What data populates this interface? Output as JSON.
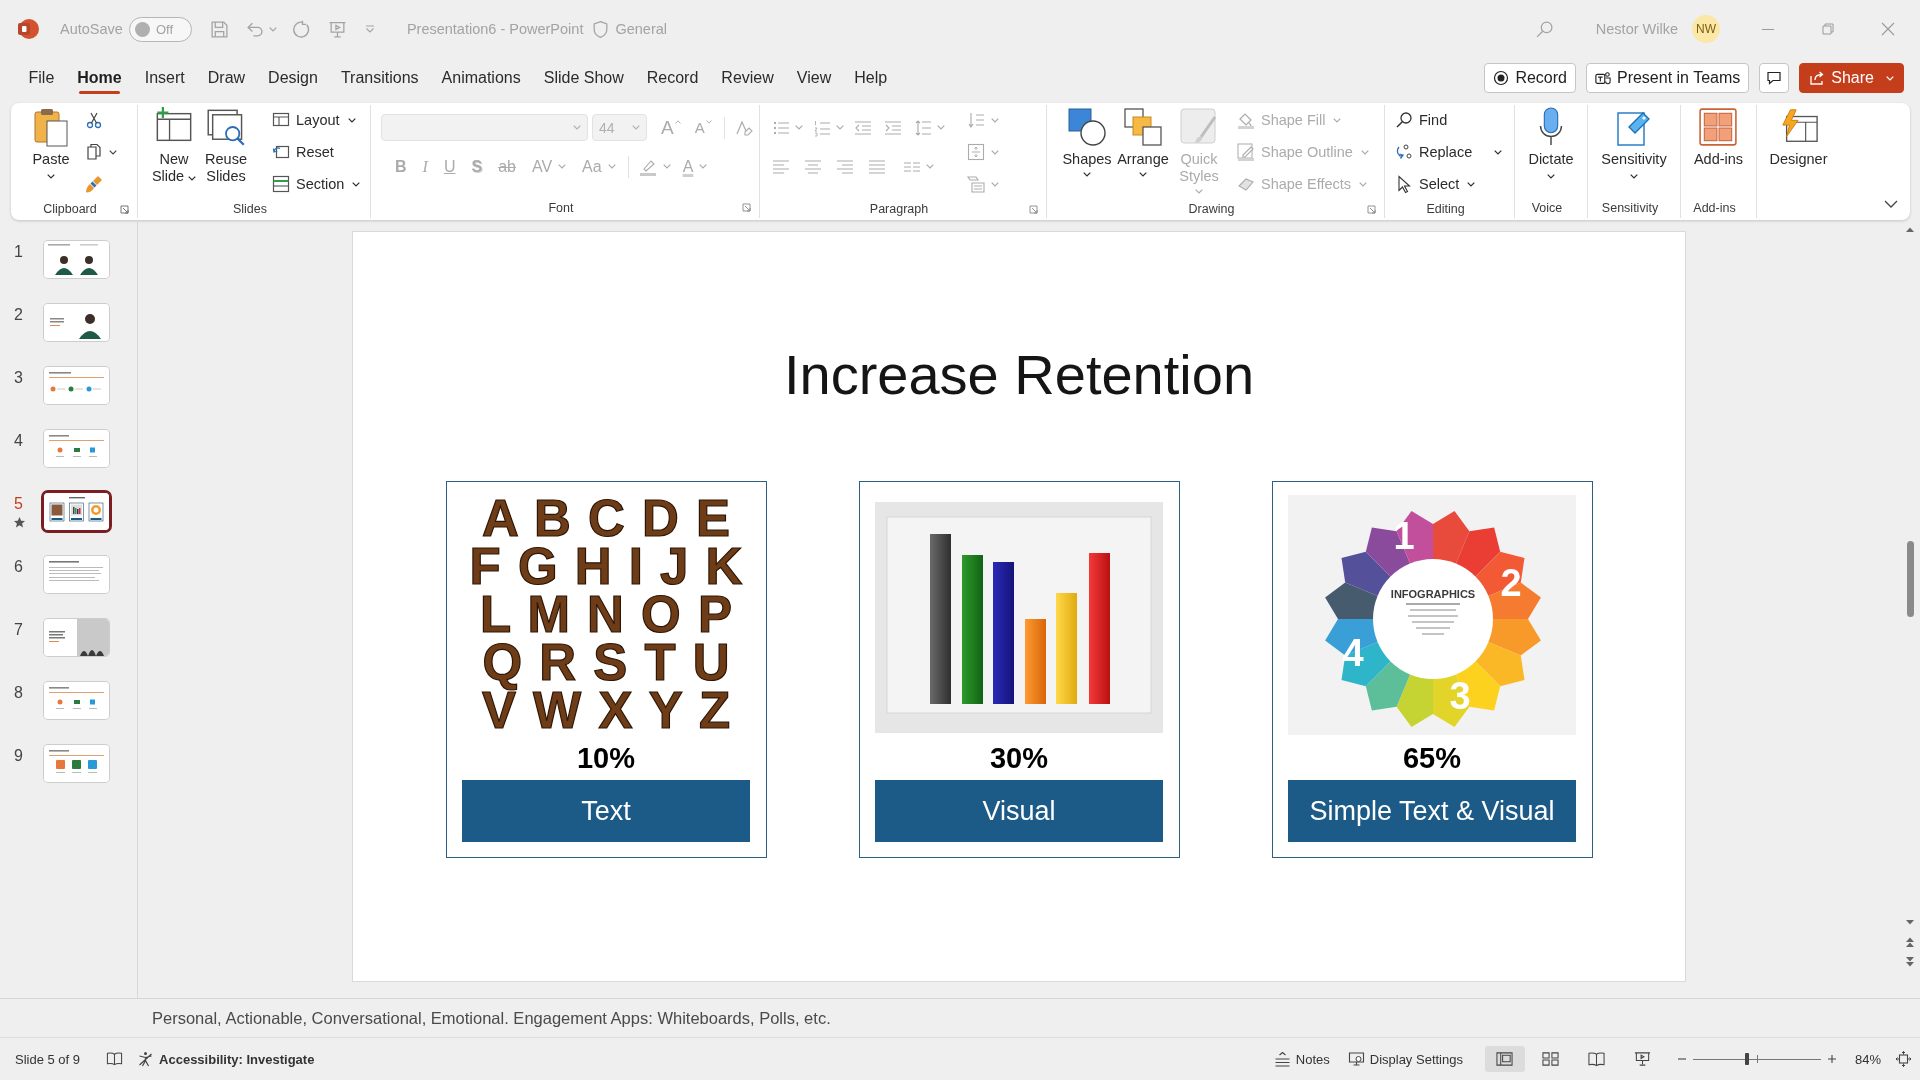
{
  "title_bar": {
    "autosave": {
      "label": "AutoSave",
      "state": "Off",
      "on": false
    },
    "document_title": "Presentation6 - PowerPoint",
    "sensitivity": "General",
    "user_name": "Nestor Wilke",
    "user_initials": "NW"
  },
  "tabs": [
    {
      "label": "File",
      "selected": false
    },
    {
      "label": "Home",
      "selected": true
    },
    {
      "label": "Insert",
      "selected": false
    },
    {
      "label": "Draw",
      "selected": false
    },
    {
      "label": "Design",
      "selected": false
    },
    {
      "label": "Transitions",
      "selected": false
    },
    {
      "label": "Animations",
      "selected": false
    },
    {
      "label": "Slide Show",
      "selected": false
    },
    {
      "label": "Record",
      "selected": false
    },
    {
      "label": "Review",
      "selected": false
    },
    {
      "label": "View",
      "selected": false
    },
    {
      "label": "Help",
      "selected": false
    }
  ],
  "tab_actions": [
    {
      "kind": "record",
      "label": "Record"
    },
    {
      "kind": "teams",
      "label": "Present in Teams"
    },
    {
      "kind": "comments"
    },
    {
      "kind": "share",
      "label": "Share"
    }
  ],
  "ribbon": {
    "clipboard": {
      "label": "Clipboard",
      "paste": "Paste"
    },
    "slides": {
      "label": "Slides",
      "large": [
        {
          "kind": "new_slide",
          "label": "New Slide",
          "caret": true
        },
        {
          "kind": "reuse",
          "label": "Reuse Slides",
          "caret": false
        }
      ],
      "small": [
        {
          "kind": "layout",
          "label": "Layout",
          "caret": true
        },
        {
          "kind": "reset",
          "label": "Reset",
          "caret": false
        },
        {
          "kind": "section",
          "label": "Section",
          "caret": true
        }
      ]
    },
    "font": {
      "label": "Font",
      "disabled": true,
      "size": "44",
      "size_buttons": [
        {
          "kind": "grow",
          "glyph": "A"
        },
        {
          "kind": "shrink",
          "glyph": "A"
        }
      ],
      "format": [
        {
          "kind": "bold",
          "glyph": "B",
          "caret": false
        },
        {
          "kind": "italic",
          "glyph": "I",
          "caret": false
        },
        {
          "kind": "underline",
          "glyph": "U",
          "caret": false
        },
        {
          "kind": "shadow",
          "glyph": "S",
          "caret": false
        },
        {
          "kind": "strike",
          "glyph": "ab",
          "caret": false
        },
        {
          "kind": "spacing",
          "glyph": "AV",
          "caret": true
        },
        {
          "kind": "case",
          "glyph": "Aa",
          "caret": true
        }
      ],
      "color_glyph": "A"
    },
    "paragraph": {
      "label": "Paragraph",
      "disabled": true
    },
    "drawing": {
      "label": "Drawing",
      "large": [
        {
          "kind": "shapes",
          "label": "Shapes",
          "disabled": false
        },
        {
          "kind": "arrange",
          "label": "Arrange",
          "disabled": false
        },
        {
          "kind": "styles",
          "label": "Quick Styles",
          "disabled": true
        }
      ],
      "small": [
        {
          "kind": "fill",
          "label": "Shape Fill",
          "disabled": true
        },
        {
          "kind": "outline",
          "label": "Shape Outline",
          "disabled": true
        },
        {
          "kind": "effects",
          "label": "Shape Effects",
          "disabled": true
        }
      ]
    },
    "editing": {
      "label": "Editing",
      "items": [
        {
          "kind": "find",
          "label": "Find",
          "caret": false
        },
        {
          "kind": "replace",
          "label": "Replace",
          "caret": true
        },
        {
          "kind": "select",
          "label": "Select",
          "caret": true
        }
      ]
    },
    "voice": {
      "label": "Voice",
      "button": "Dictate"
    },
    "sensitivity": {
      "label": "Sensitivity",
      "button": "Sensitivity"
    },
    "addins": {
      "label": "Add-ins",
      "button": "Add-ins"
    },
    "designer": {
      "button": "Designer"
    }
  },
  "thumbnails": [
    {
      "number": "1",
      "kind": "two_people",
      "selected": false,
      "animated": false
    },
    {
      "number": "2",
      "kind": "person",
      "selected": false,
      "animated": false
    },
    {
      "number": "3",
      "kind": "three_dots",
      "selected": false,
      "animated": false
    },
    {
      "number": "4",
      "kind": "three_icons",
      "selected": false,
      "animated": false
    },
    {
      "number": "5",
      "kind": "current",
      "selected": true,
      "animated": true
    },
    {
      "number": "6",
      "kind": "text",
      "selected": false,
      "animated": false
    },
    {
      "number": "7",
      "kind": "photo",
      "selected": false,
      "animated": false
    },
    {
      "number": "8",
      "kind": "three_icons",
      "selected": false,
      "animated": false
    },
    {
      "number": "9",
      "kind": "three_tiles",
      "selected": false,
      "animated": false
    }
  ],
  "slide": {
    "title": "Increase Retention",
    "cards": [
      {
        "kind": "letters",
        "rows": [
          "A B C D E",
          "F G H I J K",
          "L M N O P",
          "Q R S T U",
          "V W X Y Z"
        ],
        "percent": "10%",
        "caption": "Text"
      },
      {
        "kind": "bar_picture",
        "percent": "30%",
        "caption": "Visual"
      },
      {
        "kind": "wheel",
        "title": "INFOGRAPHICS",
        "numbers": [
          "1",
          "2",
          "3",
          "4"
        ],
        "percent": "65%",
        "caption": "Simple Text & Visual"
      }
    ]
  },
  "notes": "Personal, Actionable, Conversational, Emotional. Engagement Apps: Whiteboards, Polls, etc.",
  "status_bar": {
    "slide_info": "Slide 5 of 9",
    "accessibility": "Accessibility: Investigate",
    "notes_button": "Notes",
    "display_settings": "Display Settings",
    "views": [
      {
        "kind": "normal",
        "selected": true
      },
      {
        "kind": "sorter",
        "selected": false
      },
      {
        "kind": "reading",
        "selected": false
      },
      {
        "kind": "slideshow",
        "selected": false
      }
    ],
    "zoom": {
      "level": 0.42,
      "percent": "84%"
    }
  }
}
